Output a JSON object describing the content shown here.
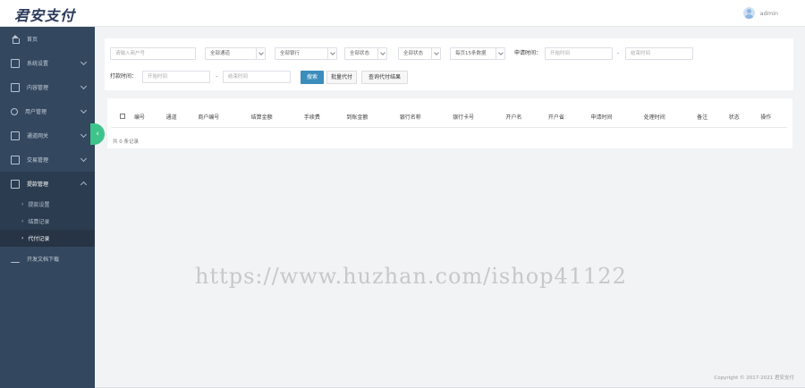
{
  "app": {
    "logo": "君安支付",
    "username": "admin"
  },
  "sidebar": {
    "items": [
      {
        "label": "首页"
      },
      {
        "label": "系统设置"
      },
      {
        "label": "内容管理"
      },
      {
        "label": "用户管理"
      },
      {
        "label": "通道网关"
      },
      {
        "label": "交易管理"
      },
      {
        "label": "提款管理"
      },
      {
        "label": "开发文档下载"
      }
    ],
    "submenu": [
      {
        "label": "提款设置"
      },
      {
        "label": "结算记录"
      },
      {
        "label": "代付记录"
      }
    ]
  },
  "filters": {
    "order_placeholder": "请输入商户号",
    "select1": "全部通道",
    "select2": "全部银行",
    "select3": "全部状态",
    "select4": "全部状态",
    "select5": "每页15条数据",
    "apply_time_label": "申请时间：",
    "start_placeholder": "开始时间",
    "end_placeholder": "结束时间",
    "pay_time_label": "打款时间：",
    "pay_start_placeholder": "开始时间",
    "pay_end_placeholder": "结束时间",
    "dash": "-",
    "search_label": "搜索",
    "batch_label": "批量代付",
    "query_label": "查询代付结果"
  },
  "table": {
    "columns": [
      "编号",
      "通道",
      "商户编号",
      "结算金额",
      "手续费",
      "到账金额",
      "银行名称",
      "银行卡号",
      "开户名",
      "开户省",
      "申请时间",
      "处理时间",
      "备注",
      "状态",
      "操作"
    ],
    "records": "共 0 条记录"
  },
  "footer": {
    "copyright": "Copyright © 2017-2021 君安支付"
  },
  "watermark": "https://www.huzhan.com/ishop41122"
}
